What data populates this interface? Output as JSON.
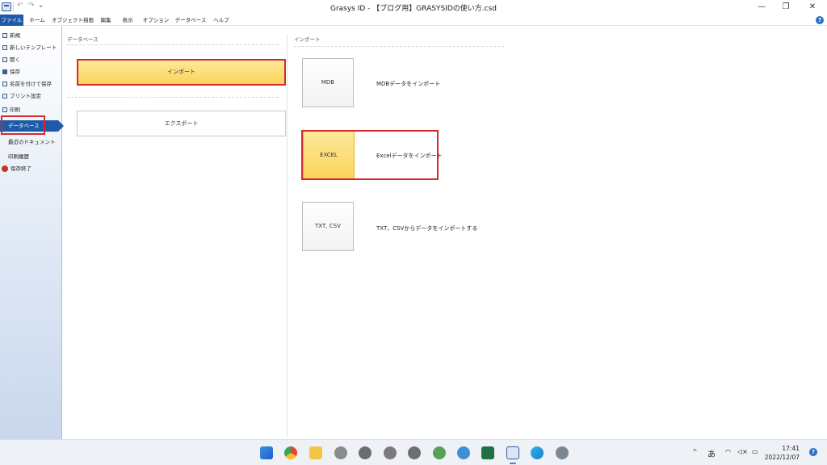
{
  "window": {
    "title": "Grasys ID - 【ブログ用】GRASYSIDの使い方.csd",
    "minimize": "—",
    "restore": "❐",
    "close": "✕"
  },
  "quick_access": {
    "undo": "↶",
    "redo": "↷",
    "more": "⏷"
  },
  "ribbon": {
    "tabs": [
      {
        "label": "ファイル"
      },
      {
        "label": "ホーム"
      },
      {
        "label": "オブジェクト描画"
      },
      {
        "label": "編集"
      },
      {
        "label": "表示"
      },
      {
        "label": "オプション"
      },
      {
        "label": "データベース"
      },
      {
        "label": "ヘルプ"
      }
    ],
    "help": "?"
  },
  "sidebar": {
    "items": [
      {
        "label": "新規"
      },
      {
        "label": "新しいテンプレート"
      },
      {
        "label": "開く"
      },
      {
        "label": "保存"
      },
      {
        "label": "名前を付けて保存"
      },
      {
        "label": "プリント設定"
      },
      {
        "label": "印刷"
      },
      {
        "label": "データベース"
      },
      {
        "label": "最近のドキュメント"
      },
      {
        "label": "印刷履歴"
      },
      {
        "label": "保存終了"
      }
    ]
  },
  "database_panel": {
    "heading": "データベース",
    "import_label": "インポート",
    "export_label": "エクスポート"
  },
  "import_panel": {
    "heading": "インポート",
    "options": [
      {
        "button": "MDB",
        "desc": "MDBデータをインポート"
      },
      {
        "button": "EXCEL",
        "desc": "Excelデータをインポート"
      },
      {
        "button": "TXT, CSV",
        "desc": "TXT、CSVからデータをインポートする"
      }
    ]
  },
  "taskbar": {
    "tray": {
      "chevron": "^",
      "ime": "あ"
    },
    "time": "17:41",
    "date": "2022/12/07",
    "notify": "?"
  }
}
